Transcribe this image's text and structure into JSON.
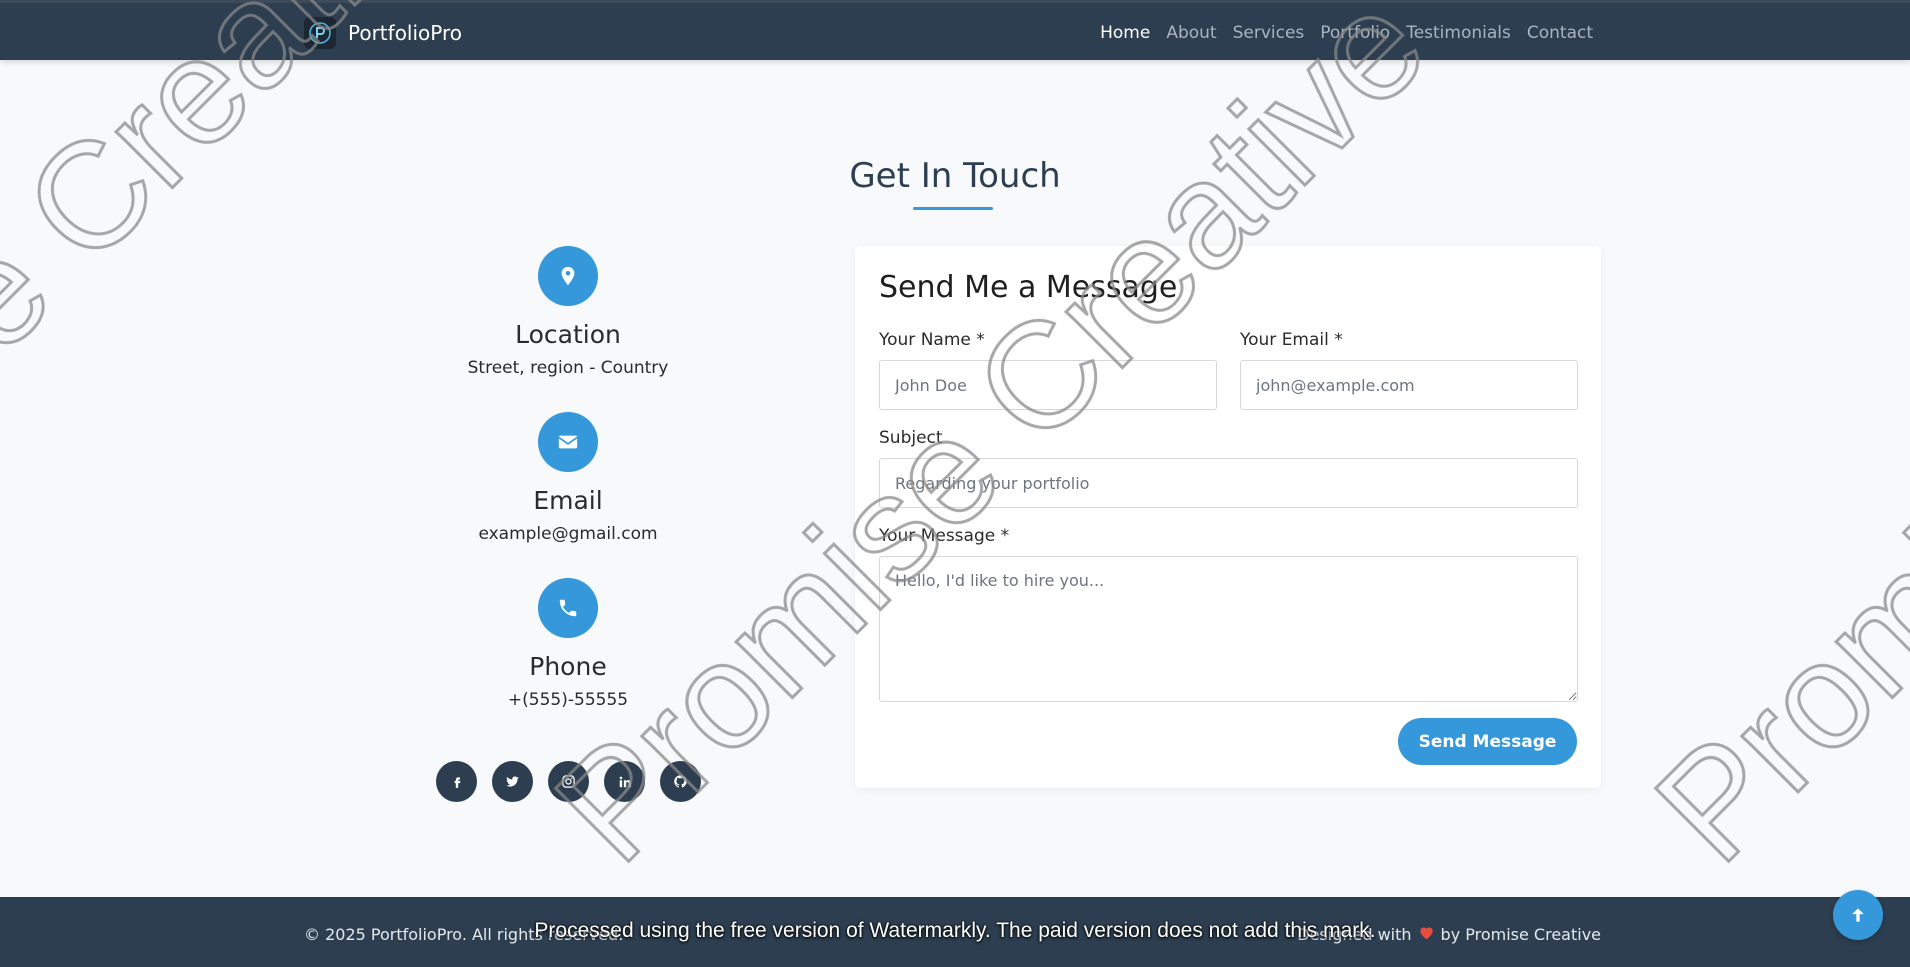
{
  "navbar": {
    "brand": "PortfolioPro",
    "logo_icon": "portfolio-p-logo-icon",
    "links": [
      {
        "label": "Home",
        "active": true
      },
      {
        "label": "About",
        "active": false
      },
      {
        "label": "Services",
        "active": false
      },
      {
        "label": "Portfolio",
        "active": false
      },
      {
        "label": "Testimonials",
        "active": false
      },
      {
        "label": "Contact",
        "active": false
      }
    ]
  },
  "section": {
    "title": "Get In Touch"
  },
  "contact_info": {
    "items": [
      {
        "icon": "map-pin-icon",
        "title": "Location",
        "value": "Street, region - Country"
      },
      {
        "icon": "envelope-icon",
        "title": "Email",
        "value": "example@gmail.com"
      },
      {
        "icon": "phone-icon",
        "title": "Phone",
        "value": "+(555)-55555"
      }
    ],
    "socials": [
      "facebook-icon",
      "twitter-icon",
      "instagram-icon",
      "linkedin-icon",
      "github-icon"
    ]
  },
  "form": {
    "title": "Send Me a Message",
    "name_label": "Your Name *",
    "name_placeholder": "John Doe",
    "email_label": "Your Email *",
    "email_placeholder": "john@example.com",
    "subject_label": "Subject",
    "subject_placeholder": "Regarding your portfolio",
    "message_label": "Your Message *",
    "message_placeholder": "Hello, I'd like to hire you...",
    "submit_label": "Send Message"
  },
  "watermark": {
    "text": "Promise Creative",
    "notice": "Processed using the free version of Watermarkly. The paid version does not add this mark."
  },
  "footer": {
    "copyright": "© 2025 PortfolioPro. All rights reserved.",
    "credit_prefix": "Designed with",
    "credit_icon": "heart-icon",
    "credit_suffix": "by Promise Creative"
  },
  "colors": {
    "navbar": "#2c3e50",
    "accent": "#3498db",
    "heart": "#e74c3c",
    "background": "#f7f9fb"
  }
}
